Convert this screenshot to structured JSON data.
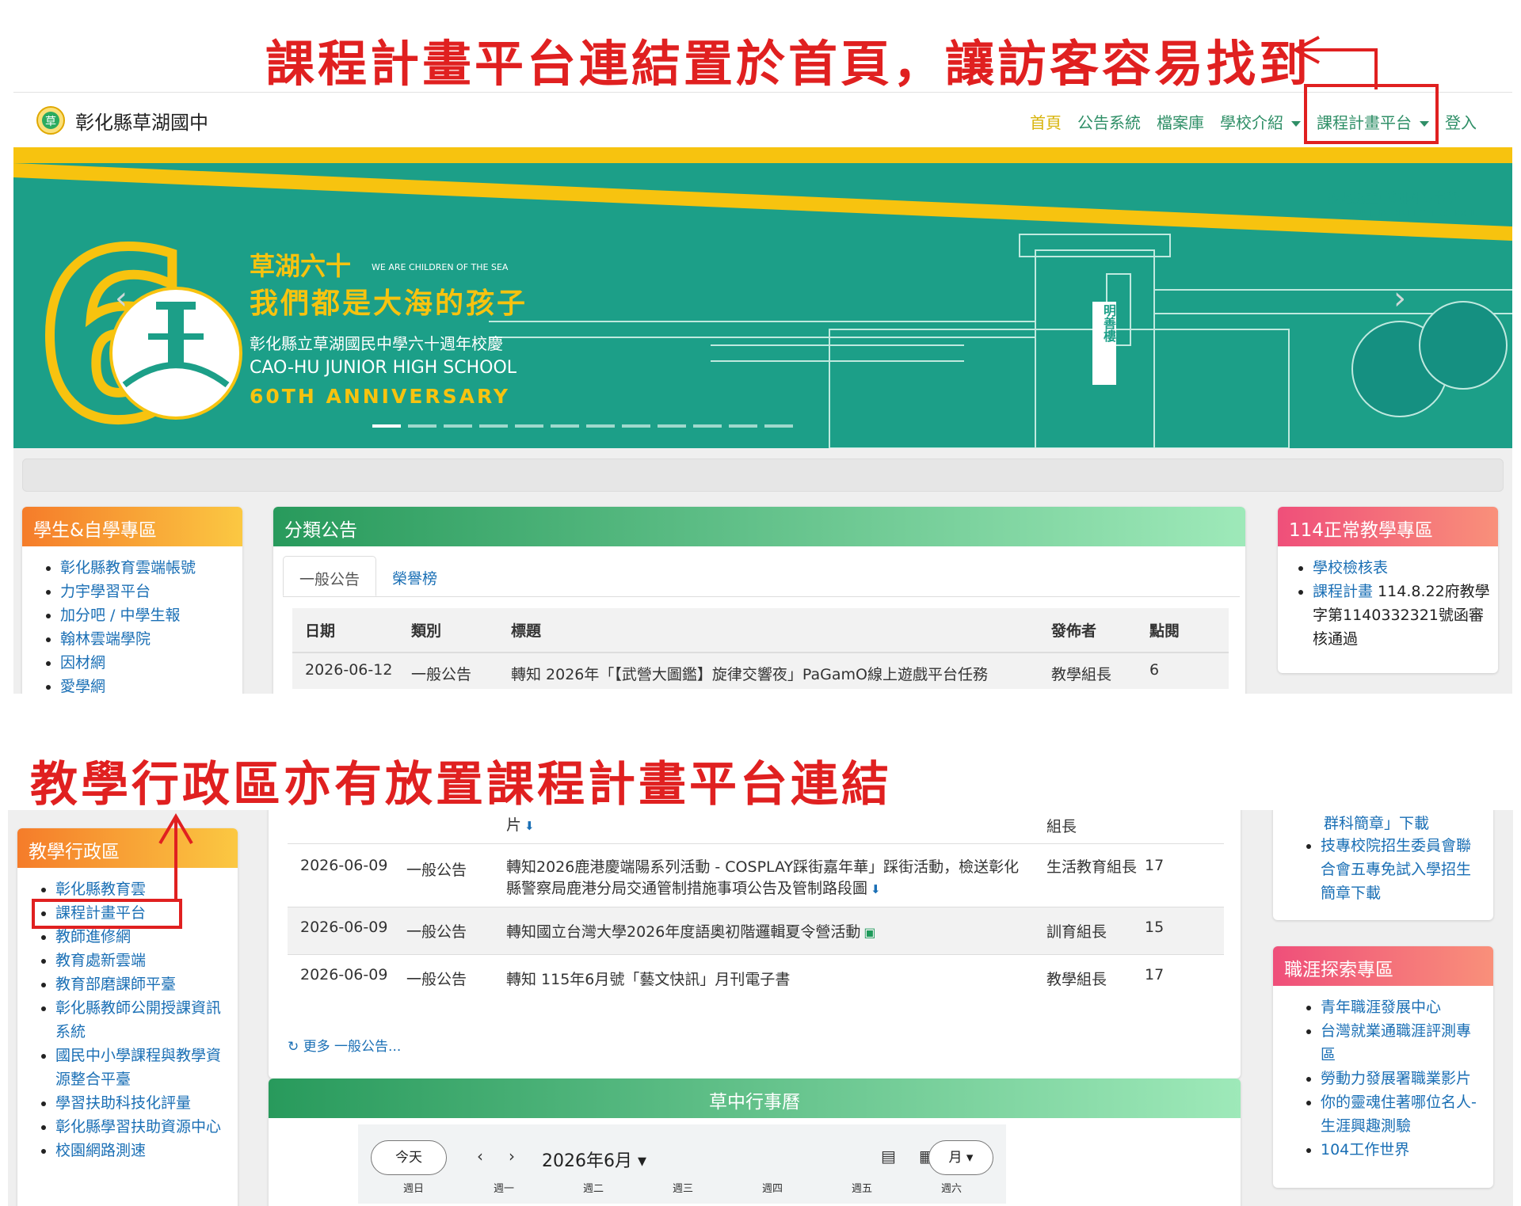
{
  "annotations": {
    "top": "課程計畫平台連結置於首頁，讓訪客容易找到",
    "middle": "教學行政區亦有放置課程計畫平台連結"
  },
  "site": {
    "name": "彰化縣草湖國中",
    "logo_icon": "school-emblem-icon"
  },
  "nav": {
    "home": "首頁",
    "announcements": "公告系統",
    "files": "檔案庫",
    "school_intro": "學校介紹",
    "course_plan": "課程計畫平台",
    "login": "登入"
  },
  "banner": {
    "title": "草湖六十",
    "title_en": "WE ARE CHILDREN OF THE SEA",
    "slogan": "我們都是大海的孩子",
    "zh_line": "彰化縣立草湖國民中學六十週年校慶",
    "en_line": "CAO-HU JUNIOR HIGH SCHOOL",
    "anniversary": "60TH ANNIVERSARY",
    "school_zh": "彰化縣立草湖國民中學",
    "school_en": "CAO-HU JUNIOR HIGH SCHOOL",
    "big_number": "60",
    "building_sign": "明善樓",
    "slide_count": 12,
    "active_slide": 1,
    "prev_icon": "chevron-left-icon",
    "next_icon": "chevron-right-icon"
  },
  "student_zone": {
    "title": "學生&自學專區",
    "links": [
      "彰化縣教育雲端帳號",
      "力宇學習平台",
      "加分吧 / 中學生報",
      "翰林雲端學院",
      "因材網",
      "愛學網"
    ]
  },
  "announcements": {
    "title": "分類公告",
    "tabs": [
      "一般公告",
      "榮譽榜"
    ],
    "columns": [
      "日期",
      "類別",
      "標題",
      "發佈者",
      "點閱"
    ],
    "rows": [
      {
        "date": "2026-06-12",
        "category": "一般公告",
        "title": "轉知 2026年「【武營大圖鑑】旋律交響夜」PaGamO線上遊戲平台任務",
        "publisher": "教學組長",
        "views": "6"
      }
    ]
  },
  "teaching_zone": {
    "title": "114正常教學專區",
    "link1": "學校檢核表",
    "link2": "課程計畫",
    "link2_note": " 114.8.22府教學字第1140332321號函審核通過"
  },
  "admin_zone": {
    "title": "教學行政區",
    "links": [
      "彰化縣教育雲",
      "課程計畫平台",
      "教師進修網",
      "教育處新雲端",
      "教育部磨課師平臺",
      "彰化縣教師公開授課資訊系統",
      "國民中小學課程與教學資源整合平臺",
      "學習扶助科技化評量",
      "彰化縣學習扶助資源中心",
      "校園網路測速"
    ]
  },
  "announcements2": {
    "partial_title_end": "片",
    "partial_publisher": "組長",
    "rows": [
      {
        "date": "2026-06-09",
        "category": "一般公告",
        "title": "轉知2026鹿港慶端陽系列活動 - COSPLAY踩街嘉年華」踩街活動，檢送彰化縣警察局鹿港分局交通管制措施事項公告及管制路段圖",
        "publisher": "生活教育組長",
        "views": "17",
        "icon": "download-icon"
      },
      {
        "date": "2026-06-09",
        "category": "一般公告",
        "title": "轉知國立台灣大學2026年度語奧初階邏輯夏令營活動",
        "publisher": "訓育組長",
        "views": "15",
        "icon": "image-icon"
      },
      {
        "date": "2026-06-09",
        "category": "一般公告",
        "title": "轉知 115年6月號「藝文快訊」月刊電子書",
        "publisher": "教學組長",
        "views": "17",
        "icon": ""
      }
    ],
    "more": "更多 一般公告..."
  },
  "right_partial": {
    "line1": "群科簡章」下載",
    "link": "技專校院招生委員會聯合會五專免試入學招生簡章下載"
  },
  "career_zone": {
    "title": "職涯探索專區",
    "links": [
      "青年職涯發展中心",
      "台灣就業通職涯評測專區",
      "勞動力發展署職業影片",
      "你的靈魂住著哪位名人-生涯興趣測驗",
      "104工作世界"
    ]
  },
  "calendar": {
    "title": "草中行事曆",
    "today": "今天",
    "month": "2026年6月",
    "view": "月",
    "days": [
      "週日",
      "週一",
      "週二",
      "週三",
      "週四",
      "週五",
      "週六"
    ]
  },
  "colors": {
    "annotation_red": "#e02020",
    "nav_green": "#2f8f67",
    "nav_active": "#d8b40b",
    "banner_teal": "#1c9f88",
    "banner_yellow": "#f7c30f",
    "link_blue": "#1a6fb5"
  }
}
